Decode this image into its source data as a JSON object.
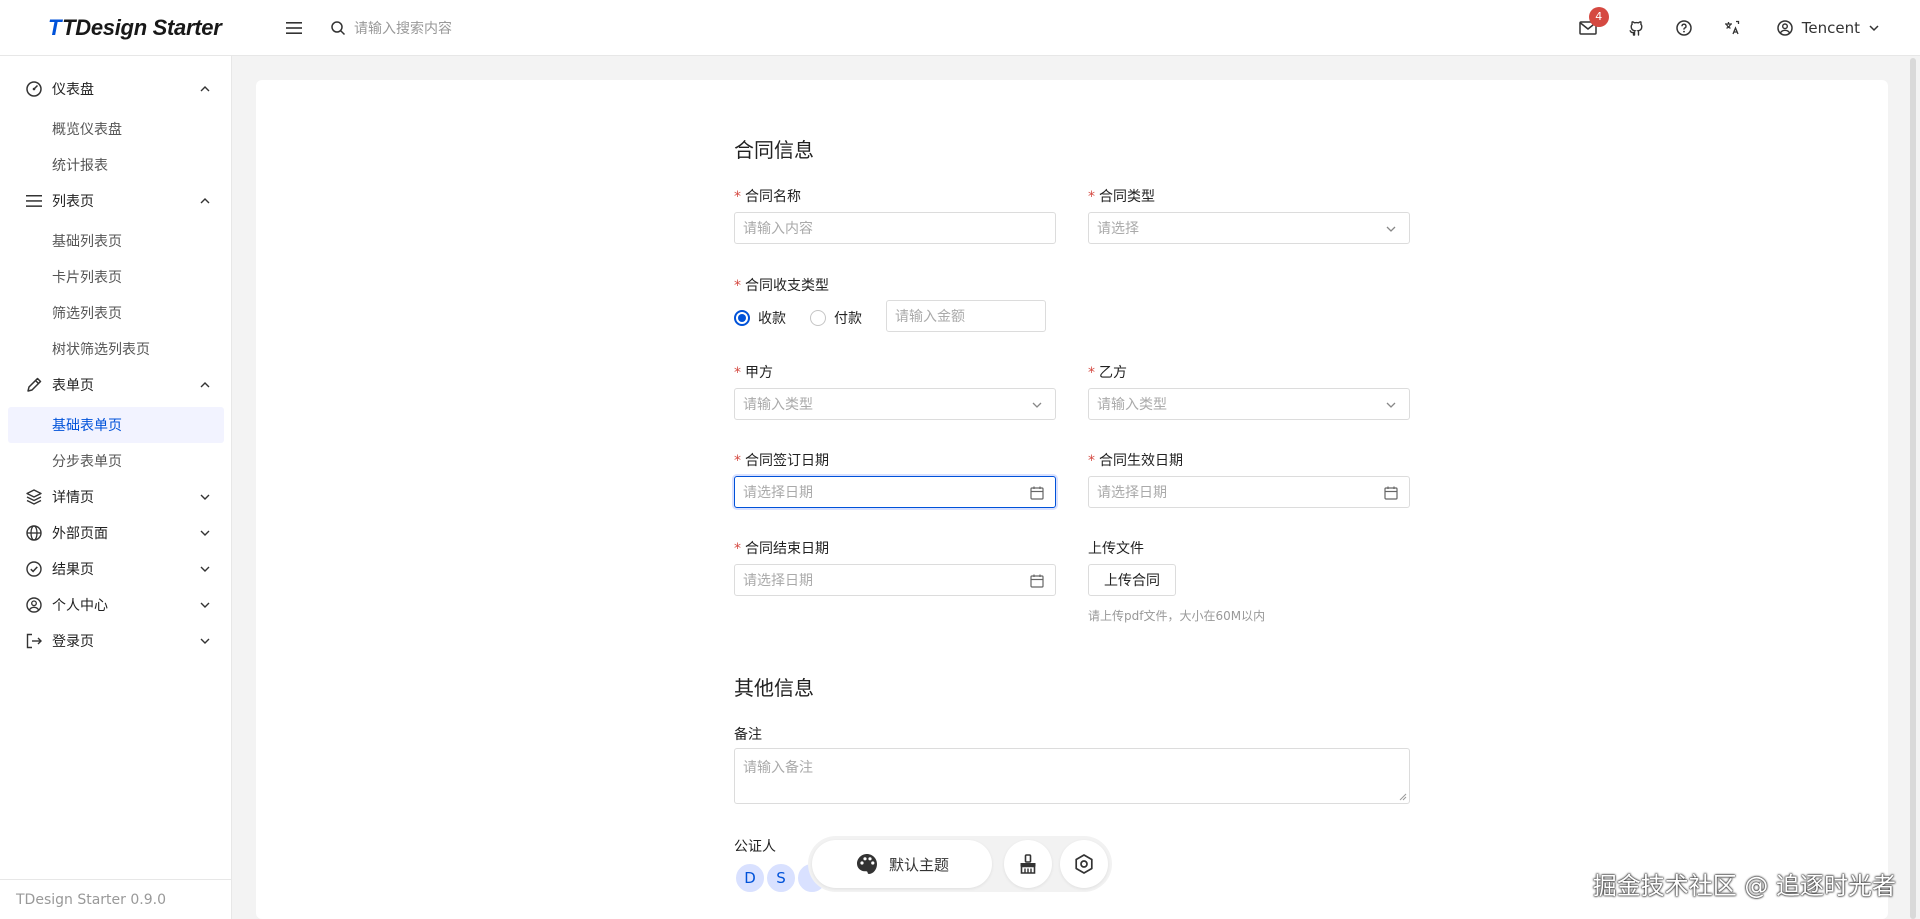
{
  "header": {
    "logo_text": "TDesign Starter",
    "search_placeholder": "请输入搜索内容",
    "notification_count": "4",
    "user_name": "Tencent"
  },
  "sidebar": {
    "groups": [
      {
        "label": "仪表盘",
        "icon": "dashboard-icon",
        "expanded": true
      },
      {
        "label": "列表页",
        "icon": "list-icon",
        "expanded": true
      },
      {
        "label": "表单页",
        "icon": "edit-icon",
        "expanded": true
      },
      {
        "label": "详情页",
        "icon": "layers-icon",
        "expanded": false
      },
      {
        "label": "外部页面",
        "icon": "globe-icon",
        "expanded": false
      },
      {
        "label": "结果页",
        "icon": "check-circle-icon",
        "expanded": false
      },
      {
        "label": "个人中心",
        "icon": "user-circle-icon",
        "expanded": false
      },
      {
        "label": "登录页",
        "icon": "logout-icon",
        "expanded": false
      }
    ],
    "items": {
      "dashboard_overview": "概览仪表盘",
      "dashboard_stats": "统计报表",
      "list_base": "基础列表页",
      "list_card": "卡片列表页",
      "list_filter": "筛选列表页",
      "list_tree": "树状筛选列表页",
      "form_base": "基础表单页",
      "form_step": "分步表单页"
    },
    "active_item": "基础表单页",
    "version": "TDesign Starter 0.9.0"
  },
  "form": {
    "section1_title": "合同信息",
    "contract_name": {
      "label": "合同名称",
      "placeholder": "请输入内容"
    },
    "contract_type": {
      "label": "合同类型",
      "placeholder": "请选择"
    },
    "payment_type": {
      "label": "合同收支类型",
      "options": [
        "收款",
        "付款"
      ],
      "selected": "收款",
      "amount_placeholder": "请输入金额"
    },
    "party_a": {
      "label": "甲方",
      "placeholder": "请输入类型"
    },
    "party_b": {
      "label": "乙方",
      "placeholder": "请输入类型"
    },
    "sign_date": {
      "label": "合同签订日期",
      "placeholder": "请选择日期"
    },
    "effective_date": {
      "label": "合同生效日期",
      "placeholder": "请选择日期"
    },
    "end_date": {
      "label": "合同结束日期",
      "placeholder": "请选择日期"
    },
    "upload": {
      "label": "上传文件",
      "button": "上传合同",
      "hint": "请上传pdf文件，大小在60M以内"
    },
    "section2_title": "其他信息",
    "remark": {
      "label": "备注",
      "placeholder": "请输入备注"
    },
    "notary": {
      "label": "公证人",
      "avatars": [
        "D",
        "S"
      ]
    }
  },
  "toolbar": {
    "theme_label": "默认主题"
  },
  "watermark": "掘金技术社区 @ 追逐时光者",
  "colors": {
    "brand": "#0052d9",
    "required": "#d54941",
    "badge": "#d54941"
  }
}
